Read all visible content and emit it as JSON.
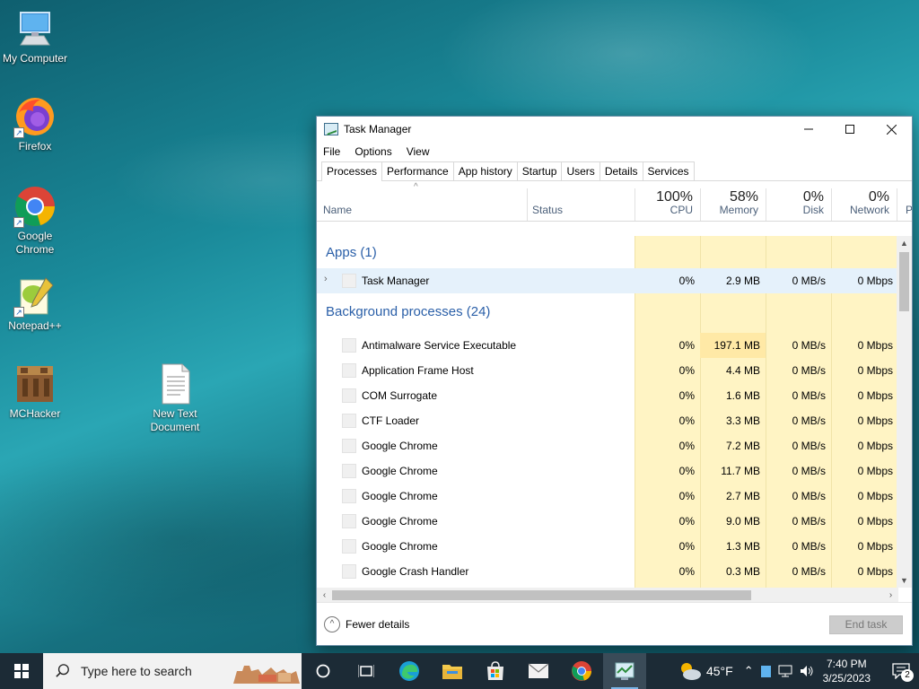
{
  "desktop": {
    "icons": [
      {
        "label": "My Computer"
      },
      {
        "label": "Firefox"
      },
      {
        "label": "Google Chrome"
      },
      {
        "label": "Notepad++"
      },
      {
        "label": "MCHacker"
      },
      {
        "label": "New Text Document"
      }
    ]
  },
  "window": {
    "title": "Task Manager",
    "menu": [
      "File",
      "Options",
      "View"
    ],
    "tabs": [
      "Processes",
      "Performance",
      "App history",
      "Startup",
      "Users",
      "Details",
      "Services"
    ],
    "active_tab": "Processes",
    "columns": {
      "name": "Name",
      "status": "Status",
      "cpu": {
        "pct": "100%",
        "label": "CPU"
      },
      "memory": {
        "pct": "58%",
        "label": "Memory"
      },
      "disk": {
        "pct": "0%",
        "label": "Disk"
      },
      "network": {
        "pct": "0%",
        "label": "Network"
      },
      "power": "P"
    },
    "groups": {
      "apps": "Apps (1)",
      "background": "Background processes (24)"
    },
    "apps": [
      {
        "name": "Task Manager",
        "cpu": "0%",
        "memory": "2.9 MB",
        "disk": "0 MB/s",
        "network": "0 Mbps"
      }
    ],
    "background": [
      {
        "name": "Antimalware Service Executable",
        "cpu": "0%",
        "memory": "197.1 MB",
        "disk": "0 MB/s",
        "network": "0 Mbps"
      },
      {
        "name": "Application Frame Host",
        "cpu": "0%",
        "memory": "4.4 MB",
        "disk": "0 MB/s",
        "network": "0 Mbps"
      },
      {
        "name": "COM Surrogate",
        "cpu": "0%",
        "memory": "1.6 MB",
        "disk": "0 MB/s",
        "network": "0 Mbps"
      },
      {
        "name": "CTF Loader",
        "cpu": "0%",
        "memory": "3.3 MB",
        "disk": "0 MB/s",
        "network": "0 Mbps"
      },
      {
        "name": "Google Chrome",
        "cpu": "0%",
        "memory": "7.2 MB",
        "disk": "0 MB/s",
        "network": "0 Mbps"
      },
      {
        "name": "Google Chrome",
        "cpu": "0%",
        "memory": "11.7 MB",
        "disk": "0 MB/s",
        "network": "0 Mbps"
      },
      {
        "name": "Google Chrome",
        "cpu": "0%",
        "memory": "2.7 MB",
        "disk": "0 MB/s",
        "network": "0 Mbps"
      },
      {
        "name": "Google Chrome",
        "cpu": "0%",
        "memory": "9.0 MB",
        "disk": "0 MB/s",
        "network": "0 Mbps"
      },
      {
        "name": "Google Chrome",
        "cpu": "0%",
        "memory": "1.3 MB",
        "disk": "0 MB/s",
        "network": "0 Mbps"
      },
      {
        "name": "Google Crash Handler",
        "cpu": "0%",
        "memory": "0.3 MB",
        "disk": "0 MB/s",
        "network": "0 Mbps"
      }
    ],
    "footer": {
      "fewer_details": "Fewer details",
      "end_task": "End task"
    }
  },
  "taskbar": {
    "search_placeholder": "Type here to search",
    "weather": "45°F",
    "time": "7:40 PM",
    "date": "3/25/2023",
    "notifications": "2"
  },
  "colors": {
    "accent_text": "#2a5fa8",
    "mem_hot": "#ffe9a6",
    "col_shade": "#fff4c4",
    "taskbar": "#1c2b36"
  }
}
